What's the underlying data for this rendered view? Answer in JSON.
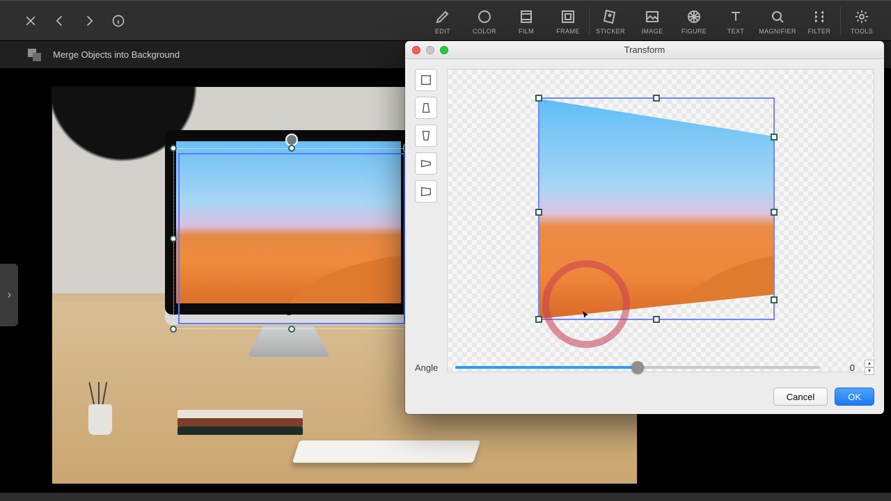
{
  "topbar": {
    "tools": [
      {
        "id": "edit",
        "label": "EDIT"
      },
      {
        "id": "color",
        "label": "COLOR"
      },
      {
        "id": "film",
        "label": "FILM"
      },
      {
        "id": "frame",
        "label": "FRAME"
      },
      {
        "id": "sticker",
        "label": "STICKER"
      },
      {
        "id": "image",
        "label": "IMAGE"
      },
      {
        "id": "figure",
        "label": "FIGURE"
      },
      {
        "id": "text",
        "label": "TEXT"
      },
      {
        "id": "magnifier",
        "label": "MAGNIFIER"
      },
      {
        "id": "filter",
        "label": "FILTER"
      },
      {
        "id": "tools",
        "label": "TOOLS"
      }
    ]
  },
  "subtoolbar": {
    "merge_label": "Merge Objects into Background"
  },
  "dialog": {
    "title": "Transform",
    "angle_label": "Angle",
    "angle_value": "0",
    "cancel_label": "Cancel",
    "ok_label": "OK",
    "modes": [
      "scale",
      "perspective-v",
      "perspective-h",
      "skew",
      "free"
    ]
  }
}
